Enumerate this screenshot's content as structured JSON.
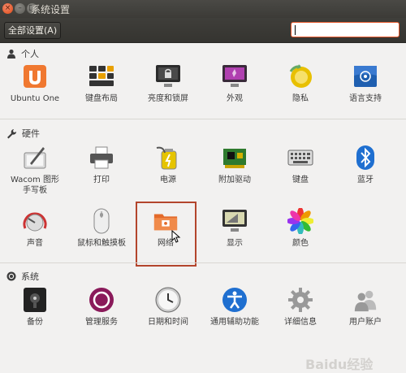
{
  "window": {
    "title": "系统设置",
    "close_icon": "×",
    "min_icon": "–",
    "max_icon": "□"
  },
  "toolbar": {
    "all_settings": "全部设置(A)",
    "search_value": ""
  },
  "sections": {
    "personal": "个人",
    "hardware": "硬件",
    "system": "系统"
  },
  "personal_items": [
    {
      "label": "Ubuntu One"
    },
    {
      "label": "键盘布局"
    },
    {
      "label": "亮度和锁屏"
    },
    {
      "label": "外观"
    },
    {
      "label": "隐私"
    },
    {
      "label": "语言支持"
    }
  ],
  "hardware_items": [
    {
      "label": "Wacom 图形\n手写板"
    },
    {
      "label": "打印"
    },
    {
      "label": "电源"
    },
    {
      "label": "附加驱动"
    },
    {
      "label": "键盘"
    },
    {
      "label": "蓝牙"
    },
    {
      "label": "声音"
    },
    {
      "label": "鼠标和触摸板"
    },
    {
      "label": "网络"
    },
    {
      "label": "显示"
    },
    {
      "label": "颜色"
    }
  ],
  "system_items": [
    {
      "label": "备份"
    },
    {
      "label": "管理服务"
    },
    {
      "label": "日期和时间"
    },
    {
      "label": "通用辅助功能"
    },
    {
      "label": "详细信息"
    },
    {
      "label": "用户账户"
    }
  ],
  "watermark": "Baidu经验"
}
